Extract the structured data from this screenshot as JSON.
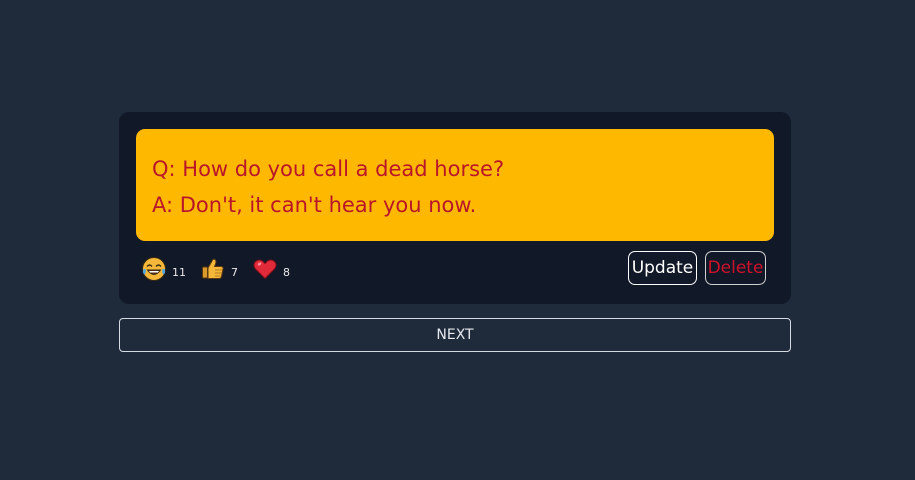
{
  "joke": {
    "question": "Q: How do you call a dead horse?",
    "answer": "A: Don't, it can't hear you now."
  },
  "reactions": [
    {
      "icon": "laughing-face-icon",
      "count": "11"
    },
    {
      "icon": "thumbs-up-icon",
      "count": "7"
    },
    {
      "icon": "heart-icon",
      "count": "8"
    }
  ],
  "actions": {
    "update_label": "Update",
    "delete_label": "Delete"
  },
  "next_label": "NEXT",
  "colors": {
    "background": "#1f2a3b",
    "card": "#111827",
    "joke_box": "#ffb800",
    "joke_text": "#b8162a",
    "delete_text": "#d0112b"
  }
}
